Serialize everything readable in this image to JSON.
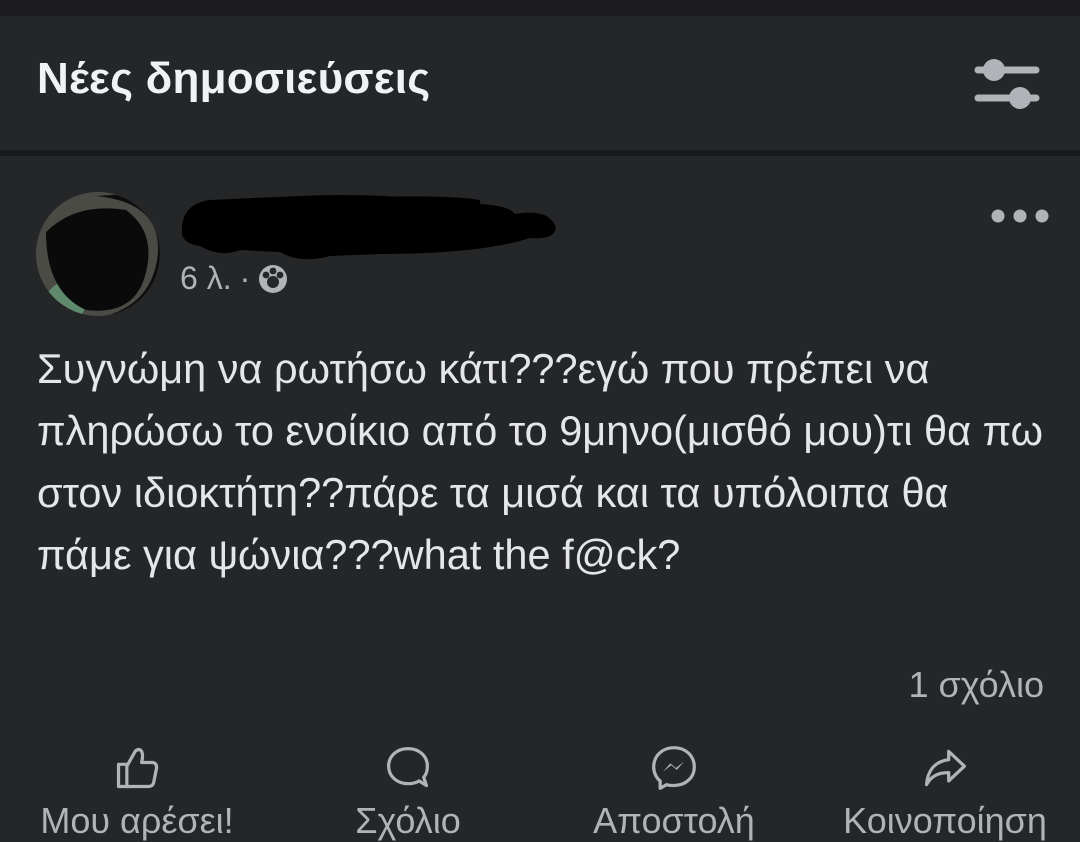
{
  "header": {
    "title": "Νέες δημοσιεύσεις",
    "filter_icon": "sliders-icon"
  },
  "post": {
    "author_name": "",
    "author_name_redacted": true,
    "time": "6 λ.",
    "separator": "·",
    "audience_icon": "group-icon",
    "more_icon": "more-horizontal-icon",
    "text": "Συγνώμη να ρωτήσω κάτι???εγώ που πρέπει να πληρώσω το ενοίκιο από το 9μηνο(μισθό μου)τι θα πω στον ιδιοκτήτη??πάρε τα μισά και τα υπόλοιπα θα πάμε για ψώνια???what the f@ck?",
    "comment_count": "1 σχόλιο"
  },
  "actions": [
    {
      "label": "Μου αρέσει!",
      "icon": "thumbs-up-icon"
    },
    {
      "label": "Σχόλιο",
      "icon": "comment-icon"
    },
    {
      "label": "Αποστολή",
      "icon": "messenger-icon"
    },
    {
      "label": "Κοινοποίηση",
      "icon": "share-icon"
    }
  ],
  "colors": {
    "background": "#252628",
    "divider": "#18191a",
    "primary_text": "#e4e6eb",
    "secondary_text": "#b0b3b8"
  }
}
